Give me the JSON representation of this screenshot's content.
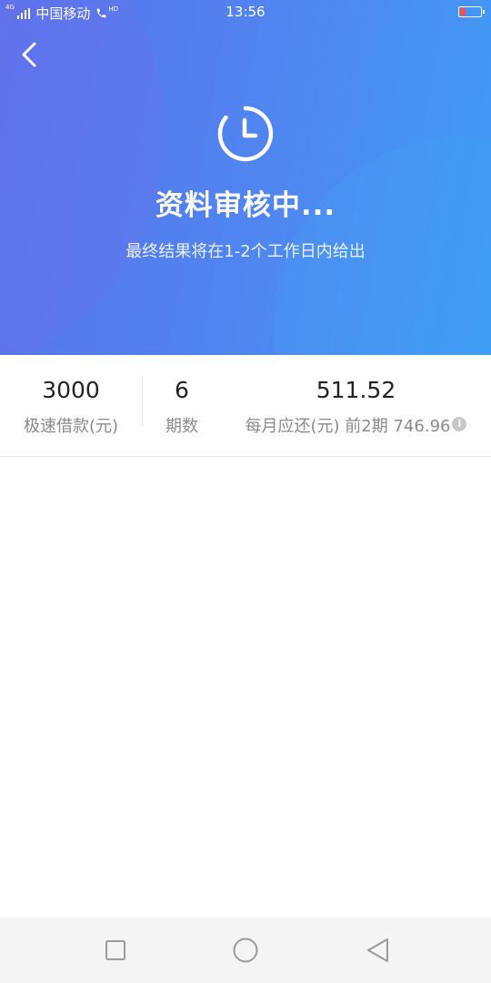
{
  "status_bar": {
    "network_badge": "4G",
    "carrier": "中国移动",
    "hd_badge": "HD",
    "time": "13:56"
  },
  "header": {
    "back_icon": "chevron-left-icon",
    "status_icon": "clock-icon",
    "title": "资料审核中...",
    "subtitle": "最终结果将在1-2个工作日内给出",
    "gradient_start": "#5a73ec",
    "gradient_end": "#3f9cf5"
  },
  "loan_info": {
    "amount": {
      "value": "3000",
      "label": "极速借款(元)"
    },
    "periods": {
      "value": "6",
      "label": "期数"
    },
    "monthly": {
      "value": "511.52",
      "label": "每月应还(元)",
      "first_periods_label": "前2期",
      "first_periods_amount": "746.96",
      "info_icon": "info-icon",
      "info_glyph": "i"
    }
  },
  "nav_bar": {
    "recent_icon": "square-icon",
    "home_icon": "circle-icon",
    "back_icon": "triangle-back-icon"
  }
}
